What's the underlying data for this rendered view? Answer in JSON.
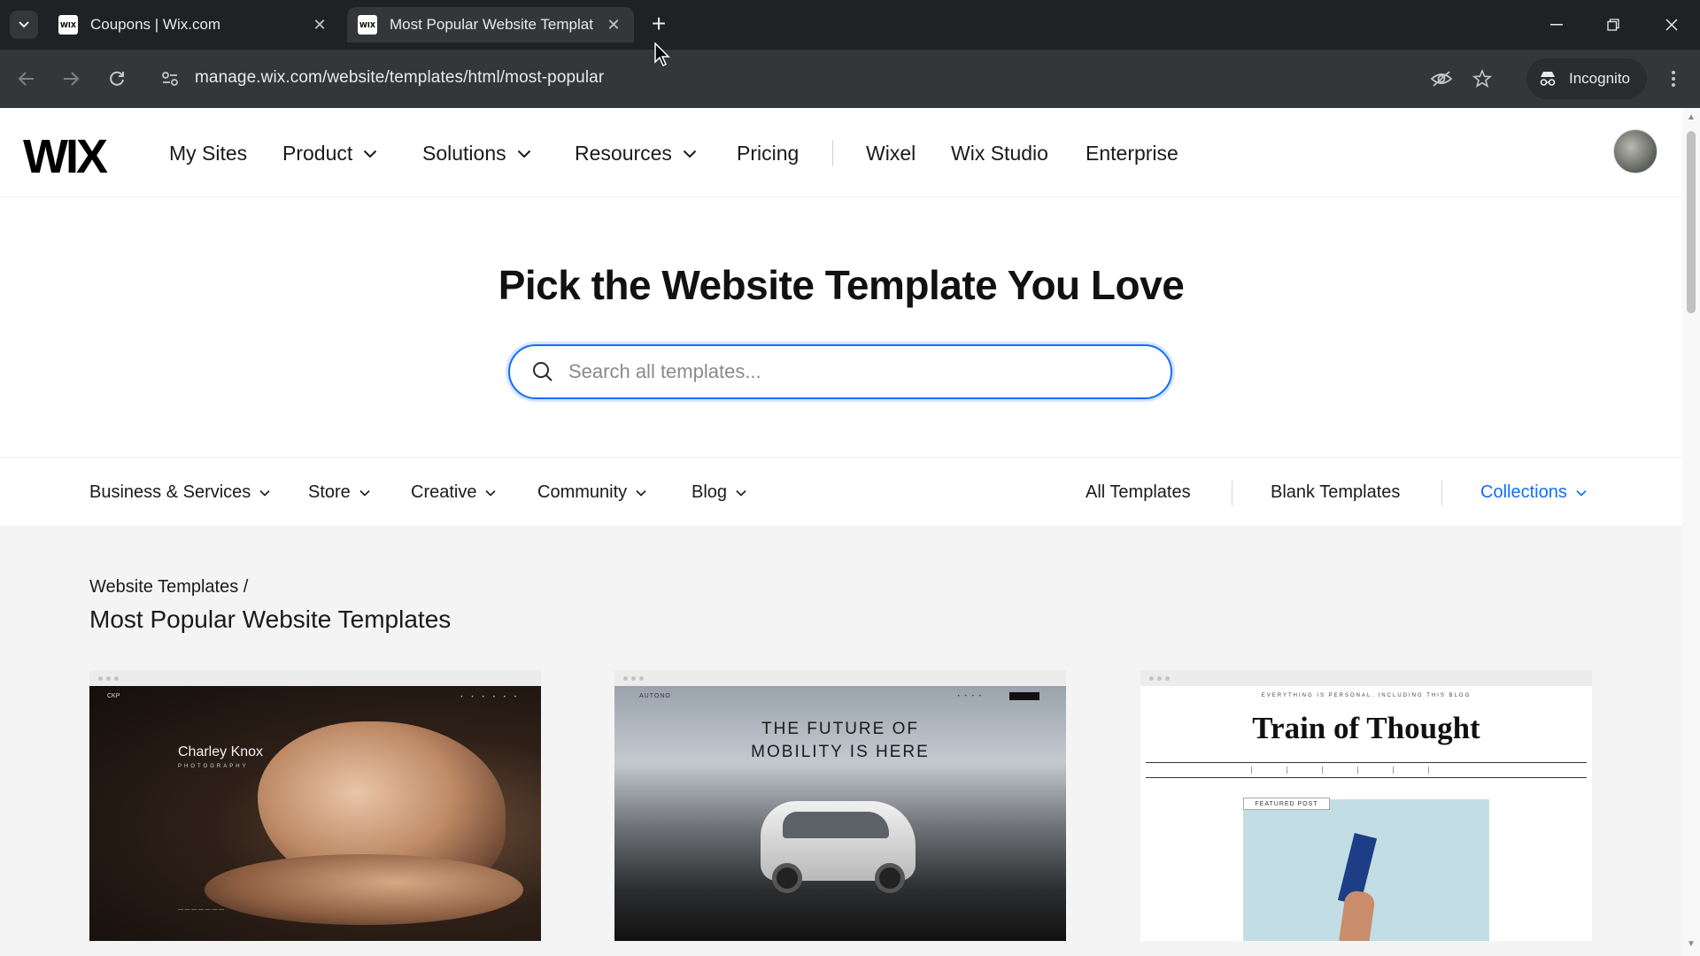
{
  "browser": {
    "tabs": [
      {
        "favicon": "WIX",
        "title": "Coupons | Wix.com",
        "active": false
      },
      {
        "favicon": "WIX",
        "title": "Most Popular Website Templat",
        "active": true
      }
    ],
    "url": "manage.wix.com/website/templates/html/most-popular",
    "incognito_label": "Incognito",
    "icons": [
      "tab-search-icon",
      "close-icon",
      "new-tab-icon",
      "minimize-icon",
      "restore-icon",
      "window-close-icon",
      "back-icon",
      "forward-icon",
      "reload-icon",
      "site-info-icon",
      "eye-off-icon",
      "star-icon",
      "incognito-icon",
      "more-icon"
    ]
  },
  "header": {
    "logo": "WIX",
    "nav": [
      {
        "label": "My Sites",
        "dropdown": false
      },
      {
        "label": "Product",
        "dropdown": true
      },
      {
        "label": "Solutions",
        "dropdown": true
      },
      {
        "label": "Resources",
        "dropdown": true
      },
      {
        "label": "Pricing",
        "dropdown": false
      },
      {
        "label": "Wixel",
        "dropdown": false
      },
      {
        "label": "Wix Studio",
        "dropdown": false
      },
      {
        "label": "Enterprise",
        "dropdown": false
      }
    ]
  },
  "hero": {
    "title": "Pick the Website Template You Love",
    "search_placeholder": "Search all templates...",
    "search_value": ""
  },
  "categories": {
    "left": [
      "Business & Services",
      "Store",
      "Creative",
      "Community",
      "Blog"
    ],
    "right": [
      "All Templates",
      "Blank Templates",
      "Collections"
    ],
    "accent_color": "#116dff"
  },
  "content": {
    "breadcrumb": "Website Templates /",
    "section_title": "Most Popular Website Templates",
    "templates": [
      {
        "name": "Charley Knox",
        "subtitle": "PHOTOGRAPHY"
      },
      {
        "headline_line1": "THE FUTURE OF",
        "headline_line2": "MOBILITY IS HERE"
      },
      {
        "kicker": "EVERYTHING IS PERSONAL. INCLUDING THIS BLOG",
        "title": "Train of Thought",
        "badge": "FEATURED POST"
      }
    ]
  }
}
